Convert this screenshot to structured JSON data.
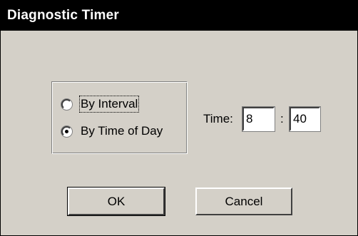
{
  "window": {
    "title": "Diagnostic Timer"
  },
  "mode_group": {
    "options": [
      {
        "label": "By Interval",
        "selected": false
      },
      {
        "label": "By Time of Day",
        "selected": true
      }
    ]
  },
  "time": {
    "label": "Time:",
    "hours": "8",
    "separator": ":",
    "minutes": "40"
  },
  "buttons": {
    "ok_label": "OK",
    "cancel_label": "Cancel"
  }
}
